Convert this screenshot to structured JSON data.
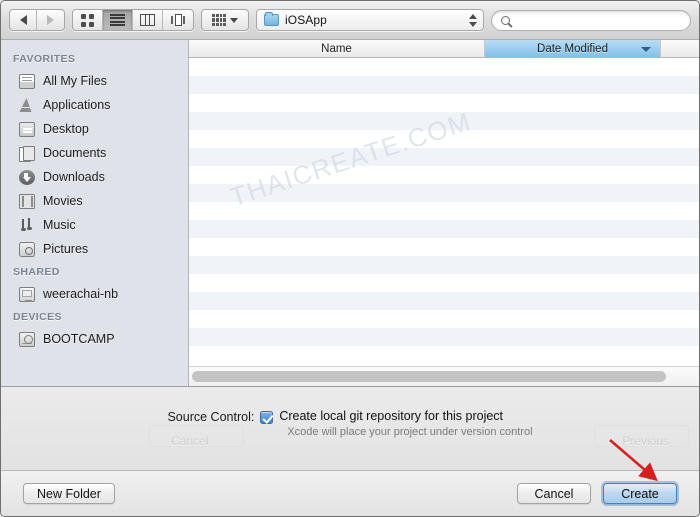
{
  "toolbar": {
    "back_label": "Back",
    "forward_label": "Forward",
    "view_icon": "icon-view-icon",
    "view_list": "list-view-icon",
    "view_column": "column-view-icon",
    "view_coverflow": "coverflow-view-icon",
    "action_label": "Action",
    "path_value": "iOSApp",
    "search_placeholder": "",
    "search_value": ""
  },
  "sidebar": {
    "sections": [
      {
        "header": "FAVORITES",
        "items": [
          {
            "label": "All My Files",
            "icon": "all-my-files-icon"
          },
          {
            "label": "Applications",
            "icon": "applications-icon"
          },
          {
            "label": "Desktop",
            "icon": "desktop-icon"
          },
          {
            "label": "Documents",
            "icon": "documents-icon"
          },
          {
            "label": "Downloads",
            "icon": "downloads-icon"
          },
          {
            "label": "Movies",
            "icon": "movies-icon"
          },
          {
            "label": "Music",
            "icon": "music-icon"
          },
          {
            "label": "Pictures",
            "icon": "pictures-icon"
          }
        ]
      },
      {
        "header": "SHARED",
        "items": [
          {
            "label": "weerachai-nb",
            "icon": "shared-computer-icon"
          }
        ]
      },
      {
        "header": "DEVICES",
        "items": [
          {
            "label": "BOOTCAMP",
            "icon": "disk-drive-icon"
          }
        ]
      }
    ]
  },
  "filelist": {
    "columns": [
      {
        "label": "Name",
        "sorted": false
      },
      {
        "label": "Date Modified",
        "sorted": true,
        "direction": "descending"
      }
    ],
    "rows": [],
    "empty": true,
    "watermark": "THAICREATE.COM"
  },
  "accessory": {
    "source_control_label": "Source Control:",
    "checkbox_checked": true,
    "checkbox_label": "Create local git repository for this project",
    "hint": "Xcode will place your project under version control",
    "ghost_cancel": "Cancel",
    "ghost_previous": "Previous"
  },
  "footer": {
    "new_folder_label": "New Folder",
    "cancel_label": "Cancel",
    "create_label": "Create"
  },
  "annotation": {
    "arrow_color": "#d81f1f",
    "points_to": "create-button"
  },
  "colors": {
    "accent_blue": "#83c0e8",
    "default_button_blue": "#a8cbec",
    "checkbox_blue": "#3d86cf",
    "sidebar_bg": "#dfe3e9",
    "stripe": "#f0f4f9"
  }
}
